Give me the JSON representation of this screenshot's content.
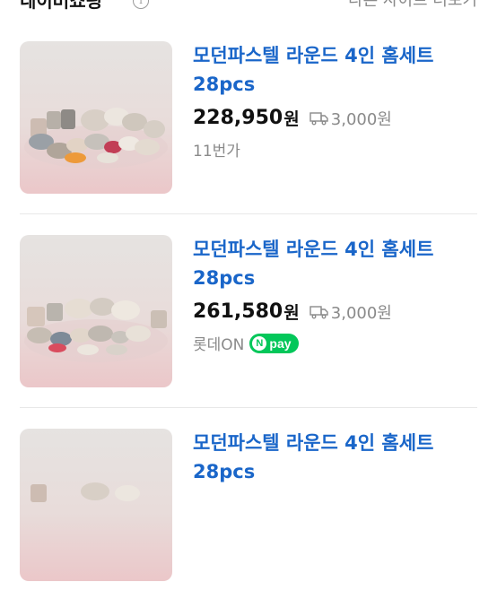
{
  "header": {
    "title": "네이버쇼핑",
    "info_icon": "info-icon",
    "see_other": "다른 사이트 더보기"
  },
  "items": [
    {
      "name": "모던파스텔 라운드 4인 홈세트 28pcs",
      "price": "228,950",
      "currency": "원",
      "shipping_icon": "truck-icon",
      "shipping": "3,000원",
      "seller": "11번가",
      "npay": false
    },
    {
      "name": "모던파스텔 라운드 4인 홈세트 28pcs",
      "price": "261,580",
      "currency": "원",
      "shipping_icon": "truck-icon",
      "shipping": "3,000원",
      "seller": "롯데ON",
      "npay": true,
      "npay_label": "pay",
      "npay_n": "N"
    },
    {
      "name": "모던파스텔 라운드 4인 홈세트 28pcs"
    }
  ],
  "colors": {
    "title_blue": "#1a66c9",
    "npay_green": "#03c75a",
    "thumb_bg_top": "#e6e3e1",
    "thumb_bg_bottom": "#ebc7c9"
  }
}
